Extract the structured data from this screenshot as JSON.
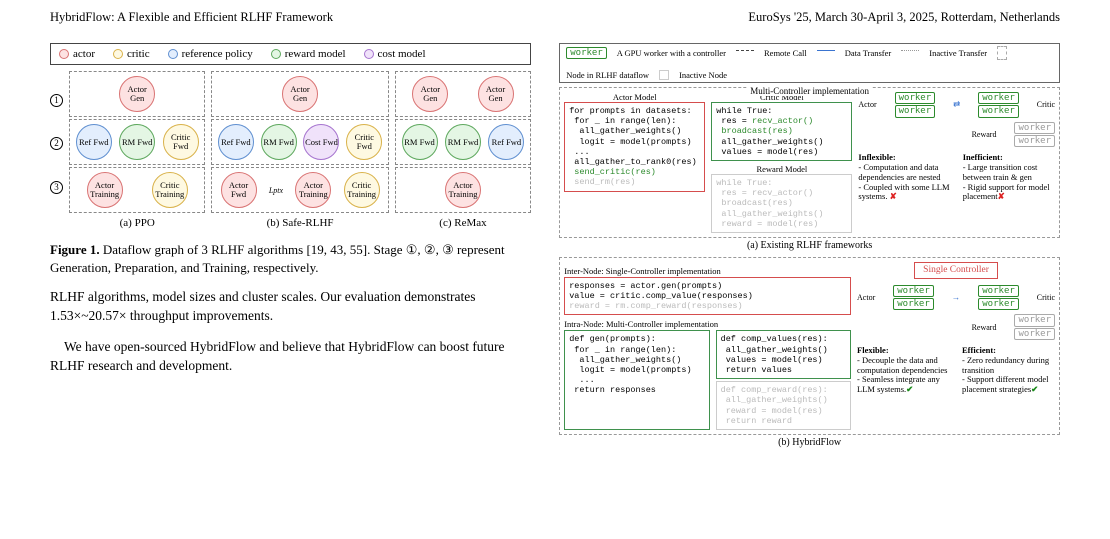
{
  "header": {
    "left": "HybridFlow: A Flexible and Efficient RLHF Framework",
    "right": "EuroSys '25, March 30-April 3, 2025, Rotterdam, Netherlands"
  },
  "fig1": {
    "legend": {
      "actor": "actor",
      "critic": "critic",
      "ref": "reference policy",
      "rm": "reward model",
      "cost": "cost model"
    },
    "stages": [
      "1",
      "2",
      "3"
    ],
    "algos": {
      "ppo": {
        "caption": "(a) PPO",
        "gen": [
          "Actor Gen"
        ],
        "prep": [
          "Ref Fwd",
          "RM Fwd",
          "Critic Fwd"
        ],
        "train": [
          "Actor Training",
          "Critic Training"
        ]
      },
      "safe": {
        "caption": "(b) Safe-RLHF",
        "gen": [
          "Actor Gen"
        ],
        "prep": [
          "Ref Fwd",
          "RM Fwd",
          "Cost Fwd",
          "Critic Fwd"
        ],
        "train": [
          "Actor Fwd",
          "Actor Training",
          "Critic Training"
        ],
        "edge_label": "Lptx"
      },
      "remax": {
        "caption": "(c) ReMax",
        "gen": [
          "Actor Gen",
          "Actor Gen"
        ],
        "prep": [
          "RM Fwd",
          "RM Fwd",
          "Ref Fwd"
        ],
        "train": [
          "Actor Training"
        ]
      }
    },
    "caption_strong": "Figure 1.",
    "caption_body": " Dataflow graph of 3 RLHF algorithms [19, 43, 55]. Stage ①, ②, ③ represent Generation, Preparation, and Training, respectively."
  },
  "body": {
    "p1": "RLHF algorithms, model sizes and cluster scales. Our evaluation demonstrates 1.53×~20.57× throughput improvements.",
    "p2": "We have open-sourced HybridFlow and believe that HybridFlow can boost future RLHF research and development."
  },
  "fig2": {
    "top_legend": {
      "worker": "worker",
      "worker_desc": "A GPU worker with a controller",
      "remote": "Remote Call",
      "data_transfer": "Data Transfer",
      "inactive_transfer": "Inactive Transfer",
      "node_in": "Node in RLHF dataflow",
      "inactive_node": "Inactive Node"
    },
    "panel_a": {
      "title": "Multi-Controller implementation",
      "actor_title": "Actor Model",
      "actor_code": "for prompts in datasets:\n for _ in range(len):\n  all_gather_weights()\n  logit = model(prompts)\n ...\n all_gather_to_rank0(res)\n send_critic(res)\n send_rm(res)",
      "critic_title": "Critic Model",
      "critic_code": "while True:\n res = recv_actor()\n broadcast(res)\n all_gather_weights()\n values = model(res)",
      "reward_title": "Reward Model",
      "reward_code": "while True:\n res = recv_actor()\n broadcast(res)\n all_gather_weights()\n reward = model(res)",
      "actor_label": "Actor",
      "critic_label": "Critic",
      "reward_label": "Reward",
      "inflexible_h": "Inflexible:",
      "inflexible_t": "- Computation and data dependencies are nested\n- Coupled with some LLM systems.",
      "inefficient_h": "Inefficient:",
      "inefficient_t": "- Large transition cost between train & gen\n- Rigid support for model placement",
      "caption": "(a) Existing RLHF frameworks"
    },
    "panel_b": {
      "inter_title": "Inter-Node: Single-Controller implementation",
      "inter_code": "responses = actor.gen(prompts)\nvalue = critic.comp_value(responses)\nreward = rm.comp_reward(responses)",
      "intra_title": "Intra-Node: Multi-Controller implementation",
      "gen_code": "def gen(prompts):\n for _ in range(len):\n  all_gather_weights()\n  logit = model(prompts)\n  ...\n return responses",
      "comp_code": "def comp_values(res):\n all_gather_weights()\n values = model(res)\n return values",
      "comp_reward_code": "def comp_reward(res):\n all_gather_weights()\n reward = model(res)\n return reward",
      "single_ctrl": "Single Controller",
      "actor_label": "Actor",
      "critic_label": "Critic",
      "reward_label": "Reward",
      "flexible_h": "Flexible:",
      "flexible_t": "- Decouple the data and computation dependencies\n- Seamless integrate any LLM systems.",
      "efficient_h": "Efficient:",
      "efficient_t": "- Zero redundancy during transition\n- Support different model placement strategies",
      "caption": "(b) HybridFlow"
    }
  }
}
